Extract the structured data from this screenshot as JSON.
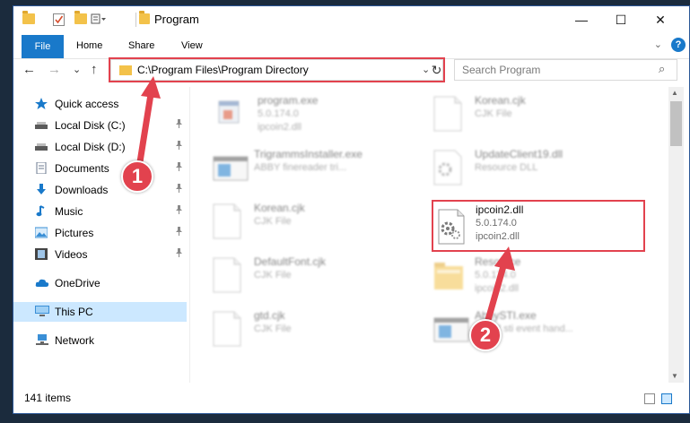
{
  "window": {
    "title": "Program",
    "controls": {
      "minimize": "—",
      "maximize": "☐",
      "close": "✕"
    }
  },
  "ribbon": {
    "tabs": [
      "File",
      "Home",
      "Share",
      "View"
    ],
    "expand": "⌄",
    "help": "?"
  },
  "navigation": {
    "back": "←",
    "forward": "→",
    "recent": "⌄",
    "up": "↑"
  },
  "address": {
    "path": "C:\\Program Files\\Program Directory",
    "dropdown": "⌄",
    "refresh": "↻"
  },
  "search": {
    "placeholder": "Search Program",
    "icon": "⌕"
  },
  "sidebar": {
    "items": [
      {
        "label": "Quick access",
        "icon": "star-icon",
        "color": "#1979ca",
        "pinned": false
      },
      {
        "label": "Local Disk (C:)",
        "icon": "drive-icon",
        "color": "#5a5a5a",
        "pinned": true
      },
      {
        "label": "Local Disk (D:)",
        "icon": "drive-icon",
        "color": "#5a5a5a",
        "pinned": true
      },
      {
        "label": "Documents",
        "icon": "documents-icon",
        "color": "#6b7a8f",
        "pinned": true
      },
      {
        "label": "Downloads",
        "icon": "download-icon",
        "color": "#1979ca",
        "pinned": true
      },
      {
        "label": "Music",
        "icon": "music-icon",
        "color": "#1979ca",
        "pinned": true
      },
      {
        "label": "Pictures",
        "icon": "pictures-icon",
        "color": "#3a8fd6",
        "pinned": true
      },
      {
        "label": "Videos",
        "icon": "videos-icon",
        "color": "#444444",
        "pinned": true
      },
      {
        "label": "OneDrive",
        "icon": "cloud-icon",
        "color": "#1979ca",
        "pinned": false
      },
      {
        "label": "This PC",
        "icon": "computer-icon",
        "color": "#3a8fd6",
        "pinned": false
      },
      {
        "label": "Network",
        "icon": "network-icon",
        "color": "#3a8fd6",
        "pinned": false
      }
    ],
    "pin_glyph": "📌"
  },
  "files": [
    {
      "name": "program.exe",
      "line1": "5.0.174.0",
      "line2": "ipcoin2.dll",
      "icon": "exe-icon"
    },
    {
      "name": "Korean.cjk",
      "line1": "CJK File",
      "line2": "",
      "icon": "document-icon"
    },
    {
      "name": "TrigrammsInstaller.exe",
      "line1": "ABBY finereader tri...",
      "line2": "",
      "icon": "installer-icon"
    },
    {
      "name": "UpdateClient19.dll",
      "line1": "Resource DLL",
      "line2": "",
      "icon": "dll-icon"
    },
    {
      "name": "Korean.cjk",
      "line1": "CJK File",
      "line2": "",
      "icon": "document-icon"
    },
    {
      "name": "ipcoin2.dll",
      "line1": "5.0.174.0",
      "line2": "ipcoin2.dll",
      "icon": "dll-gear-icon"
    },
    {
      "name": "DefaultFont.cjk",
      "line1": "CJK File",
      "line2": "",
      "icon": "document-icon"
    },
    {
      "name": "Resource",
      "line1": "5.0.174.0",
      "line2": "ipcoin2.dll",
      "icon": "folder-icon"
    },
    {
      "name": "gtd.cjk",
      "line1": "CJK File",
      "line2": "",
      "icon": "document-icon"
    },
    {
      "name": "AbbySTI.exe",
      "line1": "ABBY sti event hand...",
      "line2": "",
      "icon": "installer-icon"
    }
  ],
  "status": {
    "count": "141 items"
  },
  "annotations": {
    "badge1": "1",
    "badge2": "2",
    "color": "#e2424e"
  }
}
